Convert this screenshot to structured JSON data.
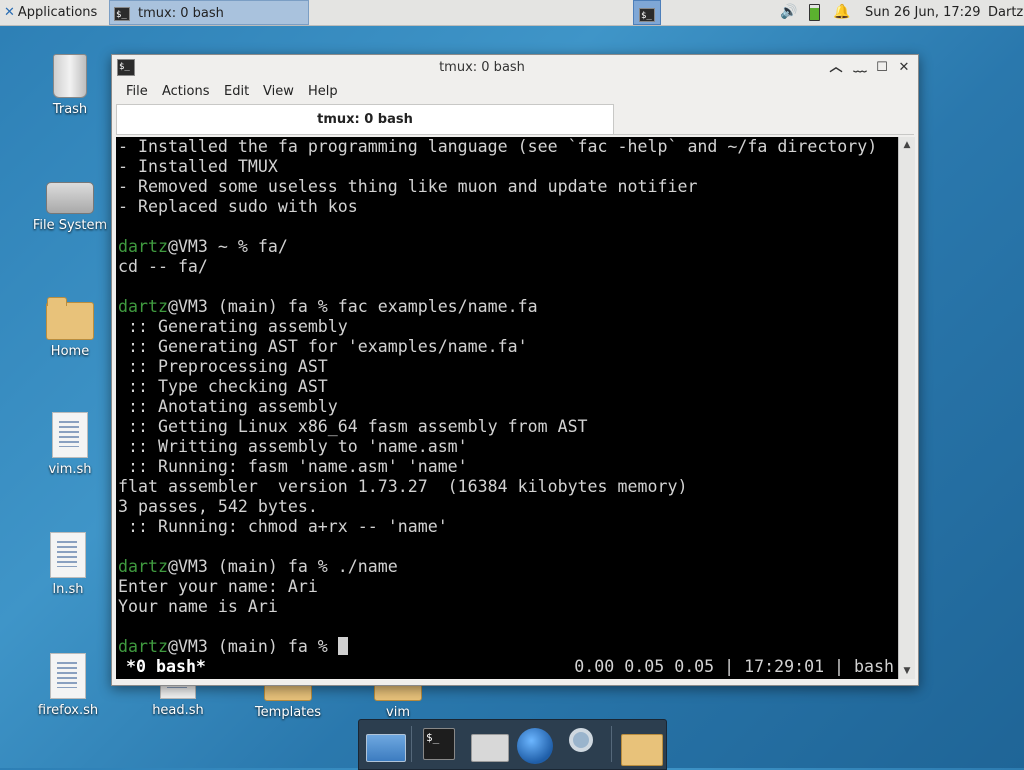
{
  "top_panel": {
    "applications_label": "Applications",
    "task_button_label": "tmux: 0 bash",
    "clock": "Sun 26 Jun, 17:29",
    "user": "Dartz"
  },
  "desktop_icons": {
    "trash": "Trash",
    "filesystem": "File System",
    "home": "Home",
    "vim_sh": "vim.sh",
    "ln_sh": "ln.sh",
    "firefox_sh": "firefox.sh",
    "head_sh": "head.sh",
    "templates": "Templates",
    "vim": "vim"
  },
  "window": {
    "title": "tmux: 0 bash",
    "menu": [
      "File",
      "Actions",
      "Edit",
      "View",
      "Help"
    ],
    "tab_label": "tmux: 0 bash"
  },
  "terminal": {
    "lines": [
      {
        "text": "- Installed the fa programming language (see `fac -help` and ~/fa directory)"
      },
      {
        "text": "- Installed TMUX"
      },
      {
        "text": "- Removed some useless thing like muon and update notifier"
      },
      {
        "text": "- Replaced sudo with kos"
      },
      {
        "text": ""
      },
      {
        "user": "dartz",
        "text": "@VM3 ~ % fa/"
      },
      {
        "text": "cd -- fa/"
      },
      {
        "text": ""
      },
      {
        "user": "dartz",
        "text": "@VM3 (main) fa % fac examples/name.fa"
      },
      {
        "text": " :: Generating assembly"
      },
      {
        "text": " :: Generating AST for 'examples/name.fa'"
      },
      {
        "text": " :: Preprocessing AST"
      },
      {
        "text": " :: Type checking AST"
      },
      {
        "text": " :: Anotating assembly"
      },
      {
        "text": " :: Getting Linux x86_64 fasm assembly from AST"
      },
      {
        "text": " :: Writting assembly to 'name.asm'"
      },
      {
        "text": " :: Running: fasm 'name.asm' 'name'"
      },
      {
        "text": "flat assembler  version 1.73.27  (16384 kilobytes memory)"
      },
      {
        "text": "3 passes, 542 bytes."
      },
      {
        "text": " :: Running: chmod a+rx -- 'name'"
      },
      {
        "text": ""
      },
      {
        "user": "dartz",
        "text": "@VM3 (main) fa % ./name"
      },
      {
        "text": "Enter your name: Ari"
      },
      {
        "text": "Your name is Ari"
      },
      {
        "text": ""
      },
      {
        "user": "dartz",
        "text": "@VM3 (main) fa % ",
        "cursor": true
      }
    ],
    "status_left": "*0 bash*",
    "status_right": "0.00 0.05 0.05 | 17:29:01 | bash"
  },
  "colors": {
    "prompt_user": "#3f9a3f",
    "terminal_bg": "#000000",
    "terminal_fg": "#d2d2d2"
  },
  "icons": [
    "xfce-logo-icon",
    "terminal-icon",
    "volume-icon",
    "battery-icon",
    "notification-bell-icon"
  ]
}
